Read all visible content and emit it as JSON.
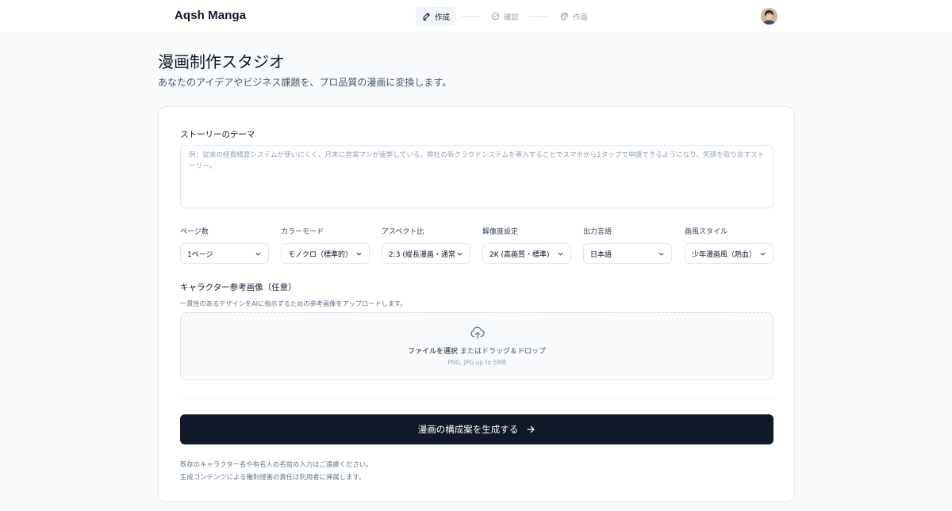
{
  "header": {
    "brand": "Aqsh Manga",
    "steps": [
      {
        "label": "作成",
        "icon": "pencil-icon",
        "active": true
      },
      {
        "label": "確認",
        "icon": "check-circle-icon",
        "active": false
      },
      {
        "label": "作画",
        "icon": "palette-icon",
        "active": false
      }
    ],
    "avatar_icon": "user-avatar"
  },
  "page": {
    "title": "漫画制作スタジオ",
    "subtitle": "あなたのアイデアやビジネス課題を、プロ品質の漫画に変換します。"
  },
  "form": {
    "theme_label": "ストーリーのテーマ",
    "theme_value": "",
    "theme_placeholder": "例：従来の経費精算システムが使いにくく、月末に営業マンが疲弊している。弊社の新クラウドシステムを導入することでスマホから1タップで申請できるようになり、笑顔を取り戻すストーリー。",
    "selects": [
      {
        "label": "ページ数",
        "value": "1ページ"
      },
      {
        "label": "カラーモード",
        "value": "モノクロ（標準的）"
      },
      {
        "label": "アスペクト比",
        "value": "2:3 (縦長漫画・通常)"
      },
      {
        "label": "解像度設定",
        "value": "2K (高画質・標準)"
      },
      {
        "label": "出力言語",
        "value": "日本語"
      },
      {
        "label": "画風スタイル",
        "value": "少年漫画風（熱血）"
      }
    ],
    "character": {
      "label": "キャラクター参考画像（任意）",
      "description": "一貫性のあるデザインをAIに指示するための参考画像をアップロードします。",
      "upload_link": "ファイルを選択",
      "upload_text": "またはドラッグ＆ドロップ",
      "upload_hint": "PNG, JPG up to 5MB",
      "icon": "cloud-upload-icon"
    },
    "generate_label": "漫画の構成案を生成する",
    "generate_icon": "arrow-right-icon",
    "notes": [
      "既存のキャラクター名や有名人の名前の入力はご遠慮ください。",
      "生成コンテンツによる権利侵害の責任は利用者に帰属します。"
    ]
  },
  "colors": {
    "background": "#f8fafc",
    "primary_button": "#111827",
    "text": "#0f172a",
    "muted": "#64748b",
    "border": "#e2e8f0"
  }
}
